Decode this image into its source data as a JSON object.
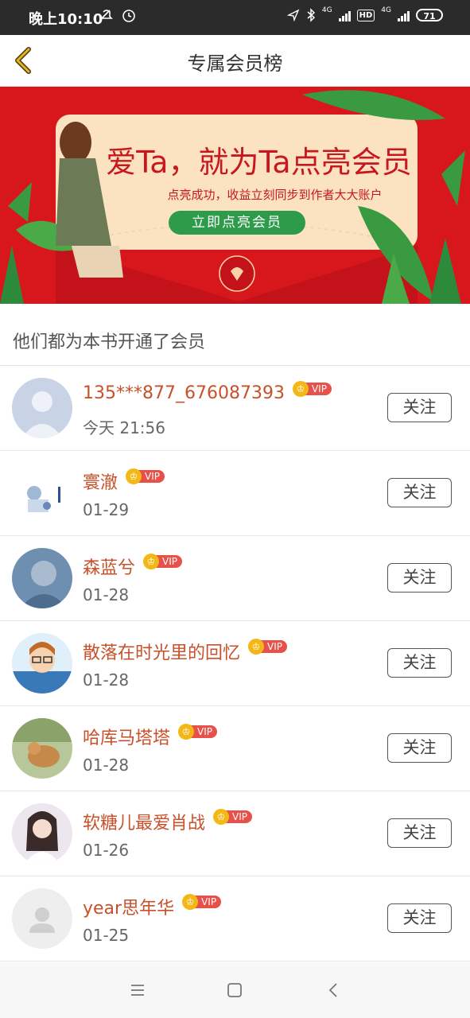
{
  "status_bar": {
    "time": "晚上10:10",
    "network_1": "4G",
    "hd_label": "HD",
    "network_2": "4G",
    "battery": "71"
  },
  "nav": {
    "title": "专属会员榜",
    "back_icon": "chevron-left-icon"
  },
  "banner": {
    "title": "爱Ta，就为Ta点亮会员",
    "subtitle": "点亮成功，收益立刻同步到作者大大账户",
    "button_label": "立即点亮会员"
  },
  "section_title": "他们都为本书开通了会员",
  "vip_label": "VIP",
  "follow_label": "关注",
  "members": [
    {
      "name": "135***877_676087393",
      "date": "今天 21:56"
    },
    {
      "name": "寰澈",
      "date": "01-29"
    },
    {
      "name": "森蓝兮",
      "date": "01-28"
    },
    {
      "name": "散落在时光里的回忆",
      "date": "01-28"
    },
    {
      "name": "哈库马塔塔",
      "date": "01-28"
    },
    {
      "name": "软糖儿最爱肖战",
      "date": "01-26"
    },
    {
      "name": "year思年华",
      "date": "01-25"
    }
  ],
  "bottom_nav": [
    "menu-icon",
    "home-square-icon",
    "back-icon"
  ],
  "colors": {
    "accent_name": "#c8502a",
    "vip_tag": "#e8514a",
    "crown": "#f3b817",
    "banner_red": "#d8171d",
    "banner_button": "#2e9b4b",
    "back_arrow": "#e6b422"
  }
}
